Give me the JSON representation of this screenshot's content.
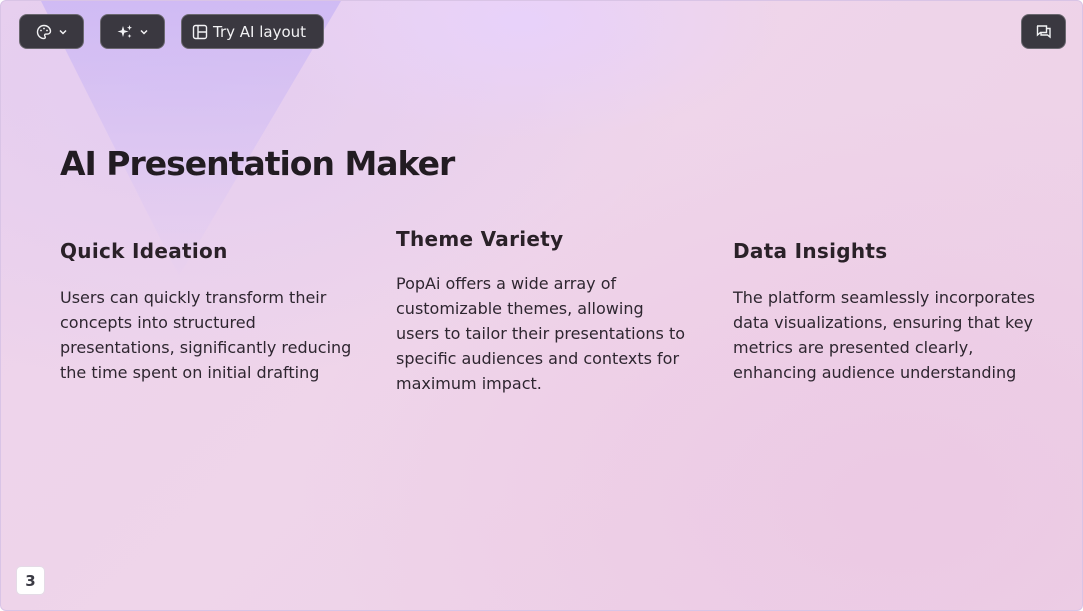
{
  "toolbar": {
    "theme_icon": "palette-icon",
    "ai_icon": "sparkles-icon",
    "layout_icon": "layout-icon",
    "layout_label": "Try AI layout",
    "comment_icon": "comment-icon"
  },
  "slide": {
    "title": "AI Presentation Maker",
    "columns": [
      {
        "heading": "Quick Ideation",
        "body": "Users can quickly transform their concepts into structured presentations, significantly reducing the time spent on initial drafting"
      },
      {
        "heading": "Theme Variety",
        "body": "PopAi offers a wide array of customizable themes, allowing users to tailor their presentations to specific audiences and contexts for maximum impact."
      },
      {
        "heading": "Data Insights",
        "body": "The platform seamlessly incorporates data visualizations, ensuring that key metrics are presented clearly, enhancing audience understanding"
      }
    ],
    "page_number": "3"
  },
  "colors": {
    "button_bg": "#3a3840",
    "title": "#221c22",
    "text": "#2e2630"
  }
}
